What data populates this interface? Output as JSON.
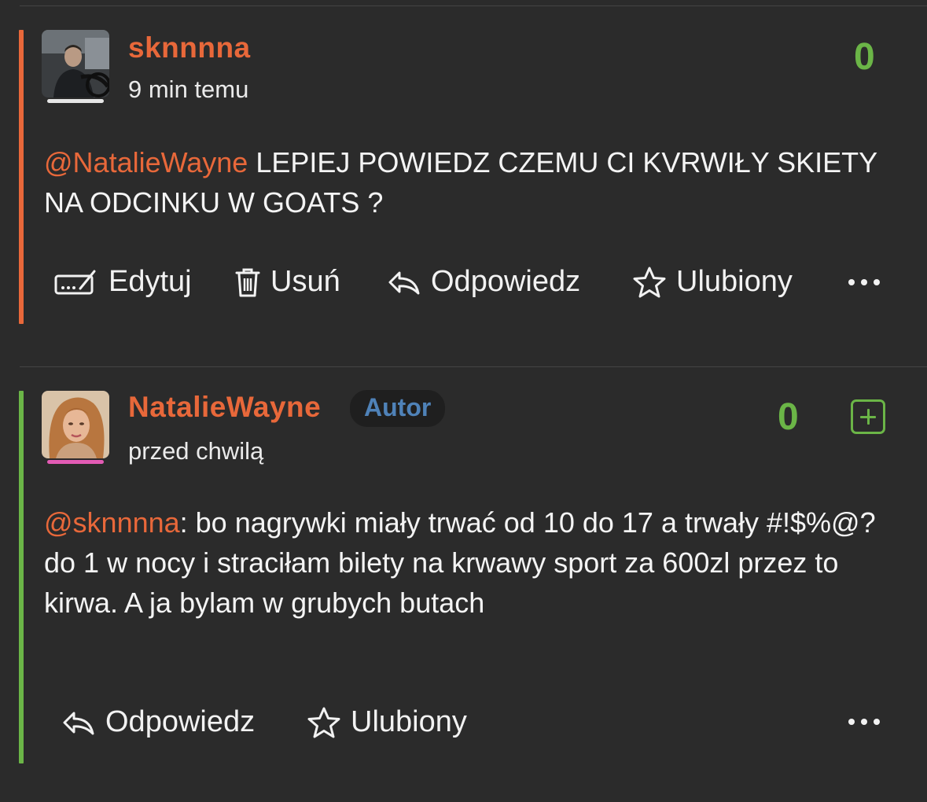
{
  "theme": {
    "background": "#2b2b2b",
    "username_color": "#e8683a",
    "mention_color": "#e8683a",
    "score_color": "#6bb547",
    "badge_text_color": "#4f82b8",
    "comment1_accent": "#e8683a",
    "comment2_accent": "#6bb547",
    "comment1_underline": "#e6e6e6",
    "comment2_underline": "#e35bb4"
  },
  "comments": [
    {
      "username": "sknnnna",
      "timestamp": "9 min temu",
      "score": "0",
      "mention": "@NatalieWayne",
      "text": " LEPIEJ POWIEDZ CZEMU CI KVRWIŁY SKIETY NA ODCINKU W GOATS ?",
      "actions": {
        "edit": "Edytuj",
        "delete": "Usuń",
        "reply": "Odpowiedz",
        "favorite": "Ulubiony"
      },
      "icons": [
        "edit-icon",
        "trash-icon",
        "reply-icon",
        "star-icon",
        "more-icon"
      ]
    },
    {
      "username": "NatalieWayne",
      "badge": "Autor",
      "timestamp": "przed chwilą",
      "score": "0",
      "mention": "@sknnnna",
      "text": ": bo nagrywki miały trwać od 10 do 17 a trwały #!$%@? do 1 w nocy i straciłam bilety na krwawy sport za 600zl przez to kirwa. A ja bylam w grubych butach",
      "actions": {
        "reply": "Odpowiedz",
        "favorite": "Ulubiony"
      },
      "icons": [
        "plus-icon",
        "reply-icon",
        "star-icon",
        "more-icon"
      ]
    }
  ]
}
